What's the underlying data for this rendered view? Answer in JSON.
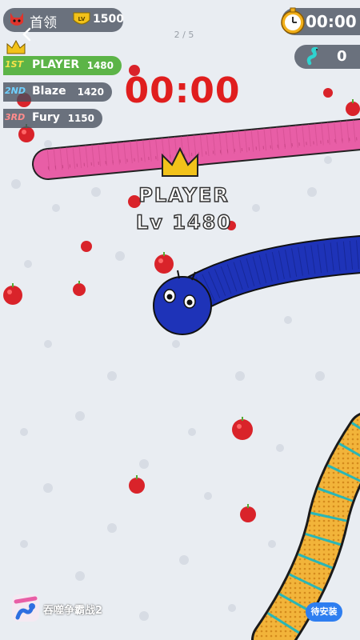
{
  "hud": {
    "boss_title": "首领",
    "boss_level_badge": "LV",
    "boss_level": "1500",
    "page_counter": "2 / 5",
    "time_left": "00:00",
    "kills": "0",
    "big_timer": "00:00"
  },
  "leaderboard": [
    {
      "rank": "1ST",
      "name": "PLAYER",
      "score": "1480"
    },
    {
      "rank": "2ND",
      "name": "Blaze",
      "score": "1420"
    },
    {
      "rank": "3RD",
      "name": "Fury",
      "score": "1150"
    }
  ],
  "player": {
    "name": "PLAYER",
    "level": "Lv 1480"
  },
  "ad": {
    "app_name": "吞噬争霸战2",
    "install_label": "待安装"
  },
  "colors": {
    "player_snake": "#1e33b8",
    "pink_snake": "#e85ea6",
    "gold_snake": "#f0a92a",
    "apple": "#d9232a",
    "timer_red": "#e01e1e",
    "first_place": "#5cb447",
    "install_button": "#2e7ef0"
  },
  "icons": {
    "boss": "devil-icon",
    "level": "shield-badge-icon",
    "back": "chevron-left-icon",
    "timer": "stopwatch-icon",
    "kills": "snake-icon",
    "leader": "crown-icon"
  }
}
